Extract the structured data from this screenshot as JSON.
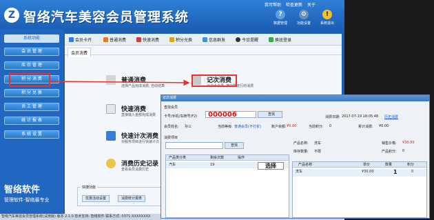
{
  "app": {
    "title": "智络汽车美容会员管理系统",
    "top_links": [
      "我可帮助",
      "检查更新",
      "关于"
    ],
    "top_buttons": [
      {
        "label": "数据管理",
        "icon": "help-icon"
      },
      {
        "label": "功能设置",
        "icon": "settings-icon"
      },
      {
        "label": "系统退出",
        "icon": "warning-icon"
      }
    ],
    "toolbar": [
      "会员卡开",
      "普通消费",
      "快速消费",
      "积分兑换",
      "信息群发",
      "今日提醒",
      "换班登录"
    ]
  },
  "sidebar": {
    "header": "系统功能",
    "items": [
      "会 员 管 理",
      "库 存 管 理",
      "积 分 消 费",
      "积 分 兑 换",
      "员 工 管 理",
      "统 计 报 表",
      "系 统 设 置"
    ],
    "brand_name": "智络软件",
    "brand_slogan": "管理软件-智络最专业"
  },
  "main": {
    "tab": "会员消费",
    "features": [
      {
        "title": "普通消费",
        "desc": "选择产品完成消费, 自动结算"
      },
      {
        "title": "记次消费",
        "desc": "计次卡会员, 按次数进行的消费"
      },
      {
        "title": "快速消费",
        "desc": "直接输入金额完成消费"
      },
      {
        "title": "快速计次消费",
        "desc": "对服务项目进行快速计次"
      },
      {
        "title": "消费历史记录",
        "desc": "查看会员消费历史"
      }
    ],
    "quick_label": "快捷功能",
    "quick_buttons": [
      "优惠活动设置",
      "消费统计报表"
    ]
  },
  "statusbar": "智络汽车美容会员管理系统(试用版) 版本 2.1.0  技术支持: 智络软件  联系方式: 0371-XXXXXXXX",
  "dialog": {
    "title": "记次消费",
    "find_section": "查找会员",
    "card_label": "卡号/手机/车牌号(F2)",
    "card_value": "000006",
    "find_btn": "查找",
    "consume_time_label": "消费日期:",
    "consume_time_value": "2017-07-19 18:05:48",
    "history_link": "历史消费",
    "member_name_label": "会员姓名:",
    "member_name_value": "孙三",
    "level_label": "当前等级:",
    "level_value": "普通会员(不打折)",
    "balance_label": "账户余额:",
    "balance_value": "¥0.00",
    "points_label": "当前积分:",
    "points_value": "0",
    "total_spend_label": "累计消费:",
    "total_spend_value": "¥0.00",
    "items_section": "消费项目",
    "search_btn": "查找",
    "left_grid": {
      "headers": [
        "产品类分类",
        "剩余次数",
        "操作"
      ],
      "rows": [
        [
          "汽车",
          "19"
        ]
      ]
    },
    "select_btn": "选择",
    "product_name_label": "产品名称:",
    "product_name_value": "洗车",
    "stock_label": "库存数量:",
    "stock_value": "不限",
    "price_label": "销售价格:",
    "price_value": "¥30.00",
    "product_points_label": "产品积分:",
    "product_points_value": "0",
    "right_grid": {
      "headers": [
        "产品名称",
        "单价",
        "数量",
        "积分"
      ],
      "rows": [
        [
          "洗车",
          "¥30.00",
          "1",
          "0"
        ]
      ]
    }
  }
}
